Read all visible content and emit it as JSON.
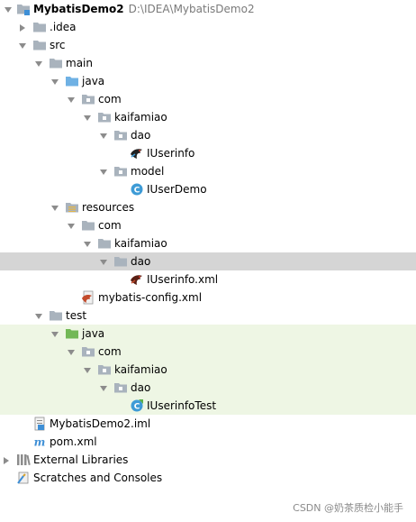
{
  "tree": {
    "root": {
      "label": "MybatisDemo2",
      "path": "D:\\IDEA\\MybatisDemo2"
    },
    "idea": "idea_label",
    "idea_label": ".idea",
    "src": "src",
    "main": "main",
    "main_java": "java",
    "com1": "com",
    "kaifamiao1": "kaifamiao",
    "dao1": "dao",
    "iuserinfo": "IUserinfo",
    "model": "model",
    "iuserdemo": "IUserDemo",
    "resources": "resources",
    "com2": "com",
    "kaifamiao2": "kaifamiao",
    "dao2": "dao",
    "iuserinfo_xml": "IUserinfo.xml",
    "mybatis_config": "mybatis-config.xml",
    "test": "test",
    "test_java": "java",
    "com3": "com",
    "kaifamiao3": "kaifamiao",
    "dao3": "dao",
    "iuserinfotest": "IUserinfoTest",
    "iml": "MybatisDemo2.iml",
    "pom": "pom.xml",
    "external_libraries": "External Libraries",
    "scratches": "Scratches and Consoles"
  },
  "watermark": "CSDN @奶茶质检小能手",
  "icons": {
    "module-folder-icon": "module",
    "folder-icon": "folder",
    "source-folder-icon": "java-source",
    "package-icon": "package",
    "mybatis-mapper-icon": "mybatis",
    "class-icon": "class",
    "test-folder-icon": "java-test",
    "resources-folder-icon": "resources",
    "xml-config-icon": "xml",
    "iml-file-icon": "iml",
    "maven-pom-icon": "maven",
    "libraries-icon": "libraries",
    "scratches-icon": "scratches"
  },
  "colors": {
    "selection": "#d5d5d5",
    "test_highlight": "#eef6e4",
    "folder": "#a9b3bd",
    "source_folder": "#6fb1e4",
    "test_folder": "#72b856",
    "class": "#3e9bd6"
  }
}
